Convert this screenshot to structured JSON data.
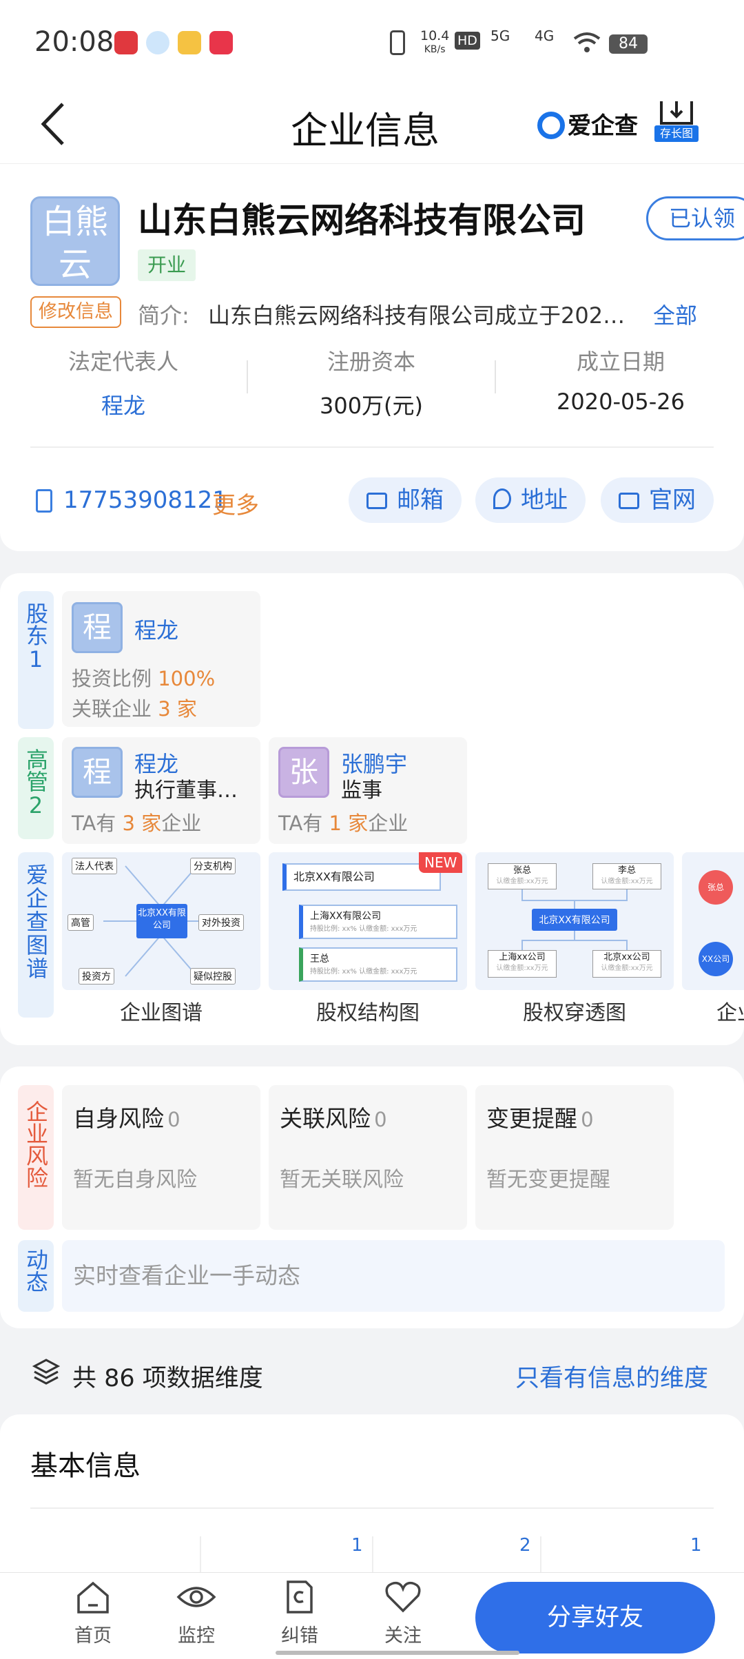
{
  "status": {
    "time": "20:08",
    "net_speed": "10.4",
    "net_unit": "KB/s",
    "signal_5g": "5G",
    "signal_4g": "4G",
    "hd": "HD",
    "battery": "84"
  },
  "nav": {
    "title": "企业信息",
    "brand": "爱企查",
    "save_long": "存长图"
  },
  "company": {
    "logo_text": "白熊云",
    "name": "山东白熊云网络科技有限公司",
    "claim": "已认领",
    "status": "开业",
    "edit": "修改信息",
    "intro_label": "简介:",
    "intro": "山东白熊云网络科技有限公司成立于2020年05月26日...",
    "intro_all": "全部",
    "stats": [
      {
        "label": "法定代表人",
        "value": "程龙"
      },
      {
        "label": "注册资本",
        "value": "300万(元)"
      },
      {
        "label": "成立日期",
        "value": "2020-05-26"
      }
    ],
    "phone": "17753908121",
    "phone_more": "更多",
    "pills": [
      "邮箱",
      "地址",
      "官网"
    ]
  },
  "shareholders": {
    "tab": "股东",
    "count": "1",
    "items": [
      {
        "avatar": "程",
        "name": "程龙",
        "ratio_label": "投资比例",
        "ratio": "100%",
        "rel_label": "关联企业",
        "rel_count": "3 家"
      }
    ]
  },
  "executives": {
    "tab": "高管",
    "count": "2",
    "items": [
      {
        "avatar": "程",
        "name": "程龙",
        "role": "执行董事…",
        "ta_prefix": "TA有",
        "ta_count": "3 家",
        "ta_suffix": "企业"
      },
      {
        "avatar": "张",
        "name": "张鹏宇",
        "role": "监事",
        "ta_prefix": "TA有",
        "ta_count": "1 家",
        "ta_suffix": "企业"
      }
    ]
  },
  "graphs": {
    "tab": "爱企查图谱",
    "items": [
      {
        "label": "企业图谱",
        "center": "北京XX有限公司",
        "nodes": [
          "法人代表",
          "分支机构",
          "高管",
          "对外投资",
          "投资方",
          "疑似控股"
        ]
      },
      {
        "label": "股权结构图",
        "badge": "NEW",
        "rows": [
          "北京XX有限公司",
          "上海XX有限公司",
          "王总"
        ],
        "sub": "持股比例: xx%    认缴金额: xxx万元"
      },
      {
        "label": "股权穿透图",
        "center": "北京XX有限公司",
        "top": [
          "张总",
          "李总"
        ],
        "bottom": [
          "上海xx公司",
          "北京xx公司"
        ],
        "sub": "认缴金额:xx万元"
      },
      {
        "label": "企业",
        "nodes": [
          "张总",
          "XX公司"
        ]
      }
    ]
  },
  "risk": {
    "tab": "企业风险",
    "items": [
      {
        "title": "自身风险",
        "count": "0",
        "empty": "暂无自身风险"
      },
      {
        "title": "关联风险",
        "count": "0",
        "empty": "暂无关联风险"
      },
      {
        "title": "变更提醒",
        "count": "0",
        "empty": "暂无变更提醒"
      }
    ],
    "dynamic_tab": "动态",
    "dynamic_text": "实时查看企业一手动态"
  },
  "dimensions": {
    "text": "共 86 项数据维度",
    "filter": "只看有信息的维度"
  },
  "basic": {
    "title": "基本信息",
    "badges": [
      "1",
      "2",
      "1"
    ]
  },
  "tabbar": {
    "items": [
      "首页",
      "监控",
      "纠错",
      "关注"
    ],
    "share": "分享好友"
  },
  "colors": {
    "accent": "#2b6fd6",
    "orange": "#e7883a",
    "green": "#3a9b50",
    "risk_red": "#e45a3c"
  }
}
